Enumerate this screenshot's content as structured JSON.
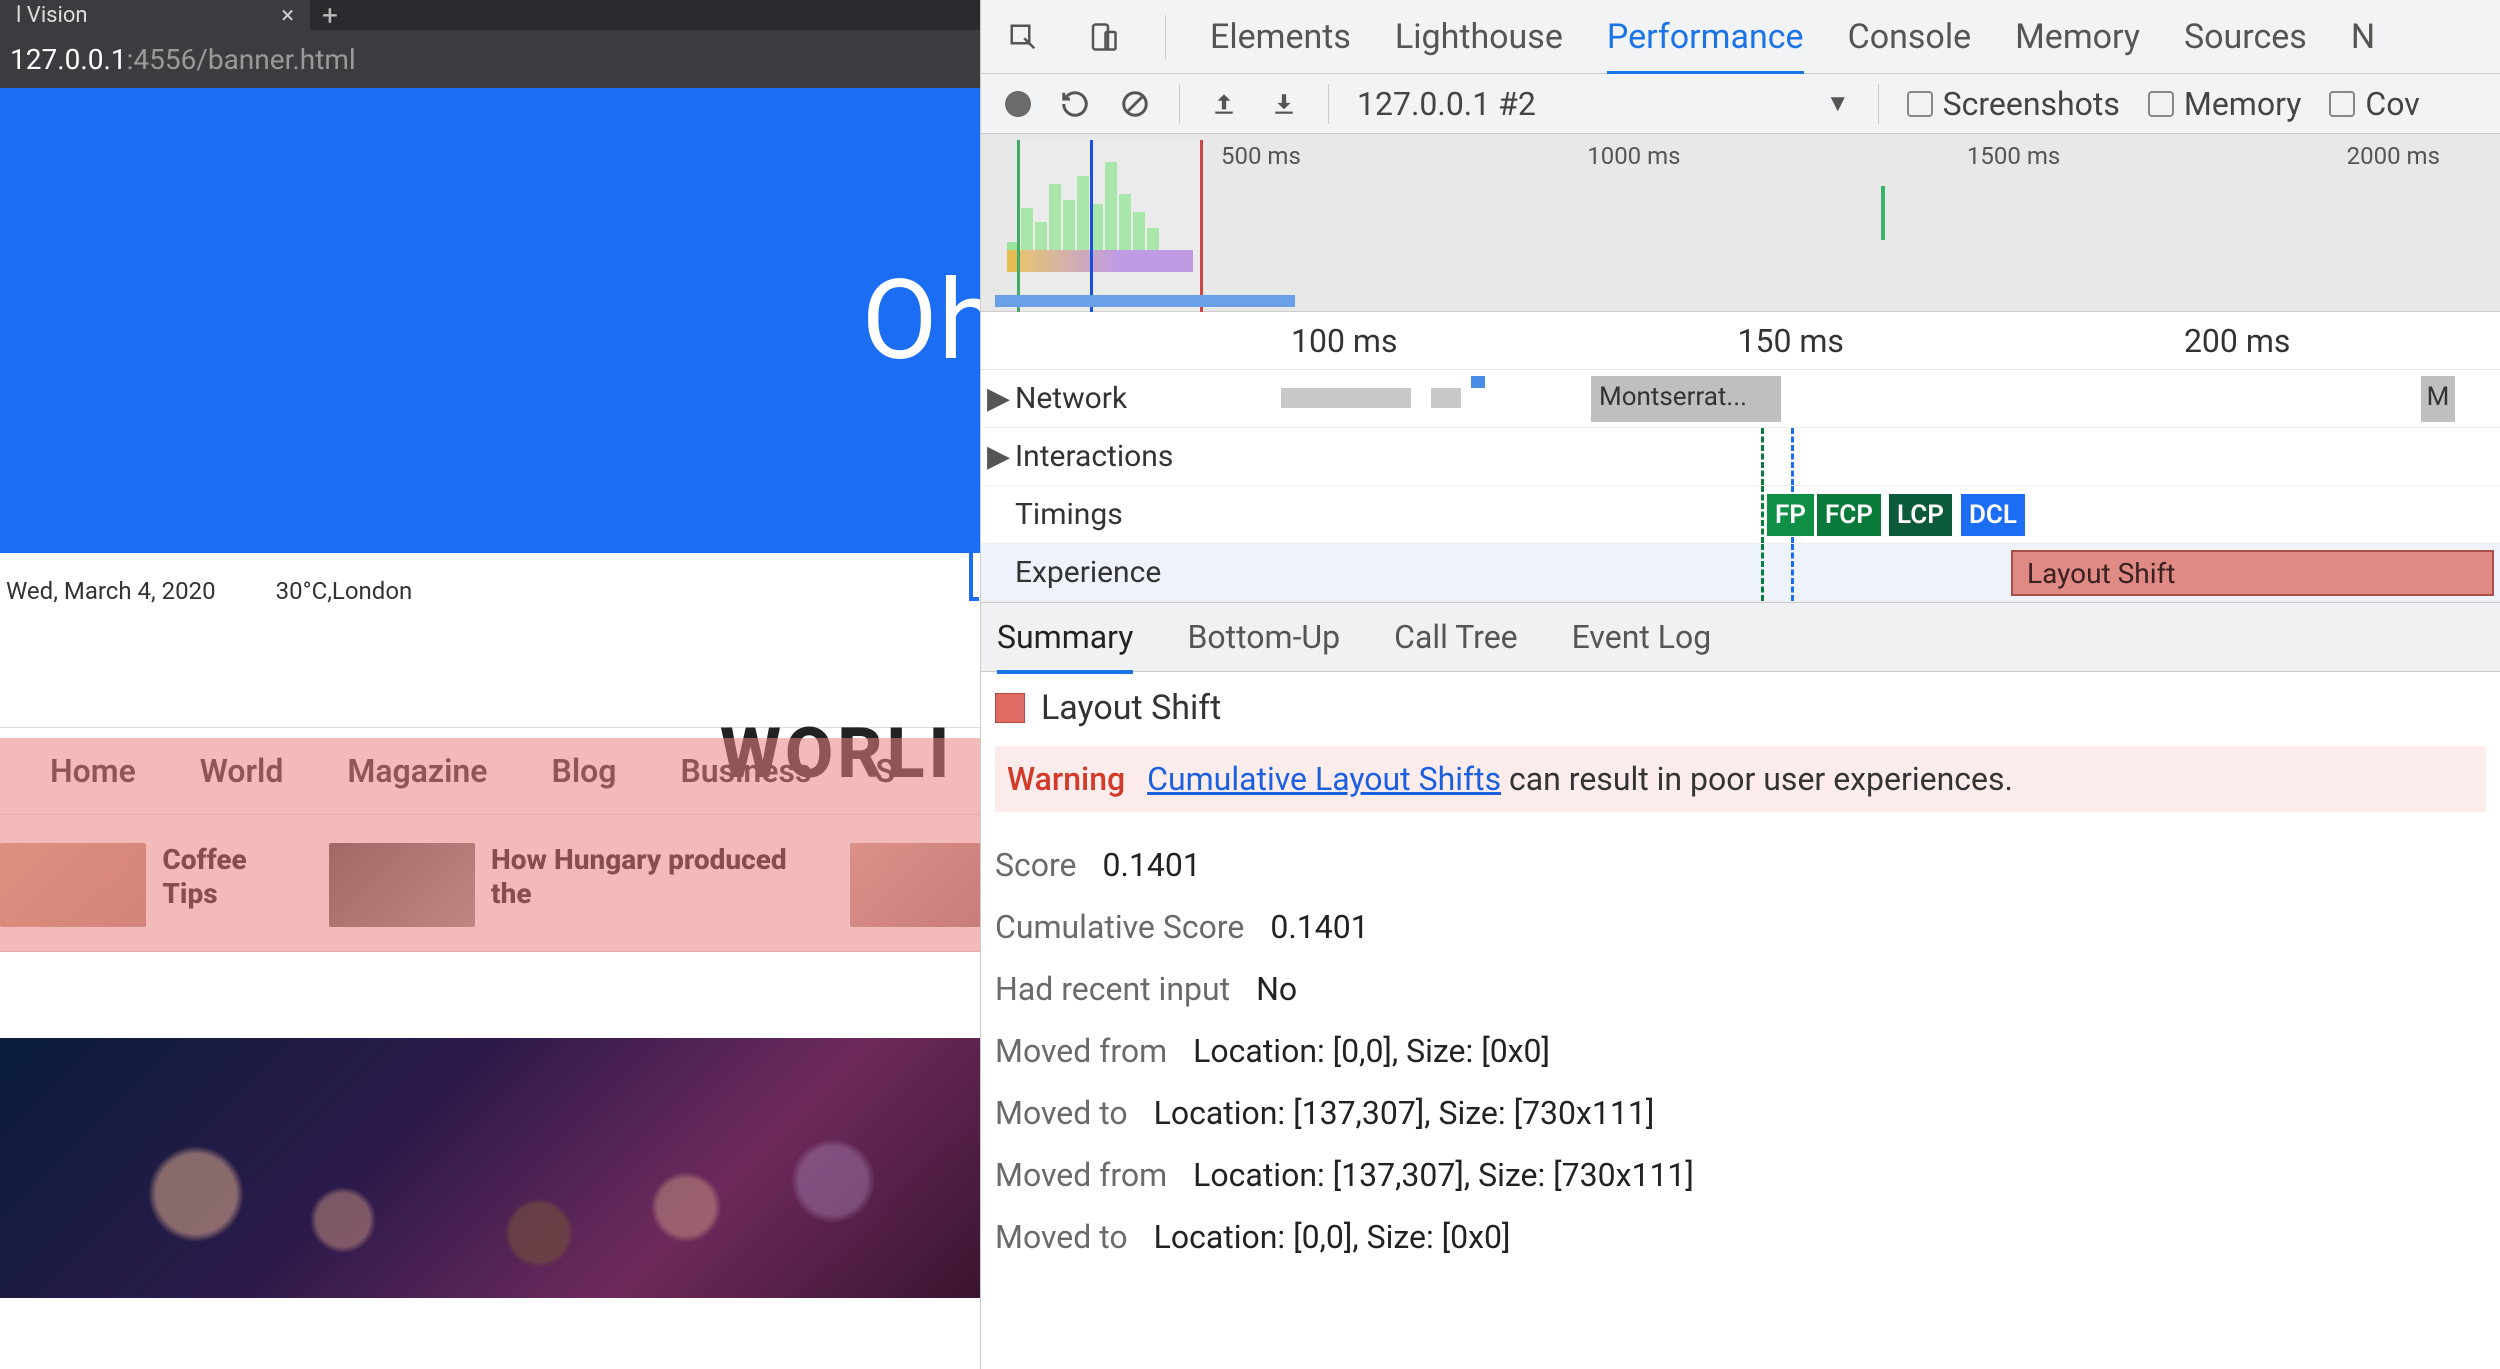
{
  "browser": {
    "tab_title": "l Vision",
    "close_glyph": "×",
    "newtab_glyph": "+",
    "address_host": "127.0.0.1",
    "address_path": ":4556/banner.html"
  },
  "page": {
    "hero_text": "Oh",
    "date": "Wed, March 4, 2020",
    "weather": "30°C,London",
    "site_title": "WORLI",
    "nav": [
      "Home",
      "World",
      "Magazine",
      "Blog",
      "Business",
      "S"
    ],
    "card1": "Coffee Tips",
    "card2": "How Hungary produced the"
  },
  "devtools": {
    "panel_tabs": [
      "Elements",
      "Lighthouse",
      "Performance",
      "Console",
      "Memory",
      "Sources",
      "N"
    ],
    "active_panel": "Performance",
    "toolbar": {
      "profile": "127.0.0.1 #2",
      "screenshots": "Screenshots",
      "memory": "Memory",
      "cov": "Cov"
    },
    "overview_ticks": [
      "500 ms",
      "1000 ms",
      "1500 ms",
      "2000 ms"
    ],
    "flame_ticks": [
      "100 ms",
      "150 ms",
      "200 ms"
    ],
    "rows": {
      "network": "Network",
      "interactions": "Interactions",
      "timings": "Timings",
      "experience": "Experience"
    },
    "net_block": "Montserrat...",
    "net_tail": "M",
    "timings": {
      "fp": "FP",
      "fcp": "FCP",
      "lcp": "LCP",
      "dcl": "DCL"
    },
    "experience_bar": "Layout Shift",
    "detail_tabs": [
      "Summary",
      "Bottom-Up",
      "Call Tree",
      "Event Log"
    ],
    "active_detail": "Summary",
    "event_name": "Layout Shift",
    "warning_label": "Warning",
    "warning_link": "Cumulative Layout Shifts",
    "warning_rest": " can result in poor user experiences.",
    "kv": [
      {
        "k": "Score",
        "v": "0.1401"
      },
      {
        "k": "Cumulative Score",
        "v": "0.1401"
      },
      {
        "k": "Had recent input",
        "v": "No"
      },
      {
        "k": "Moved from",
        "v": "Location: [0,0], Size: [0x0]"
      },
      {
        "k": "Moved to",
        "v": "Location: [137,307], Size: [730x111]"
      },
      {
        "k": "Moved from",
        "v": "Location: [137,307], Size: [730x111]"
      },
      {
        "k": "Moved to",
        "v": "Location: [0,0], Size: [0x0]"
      }
    ]
  }
}
